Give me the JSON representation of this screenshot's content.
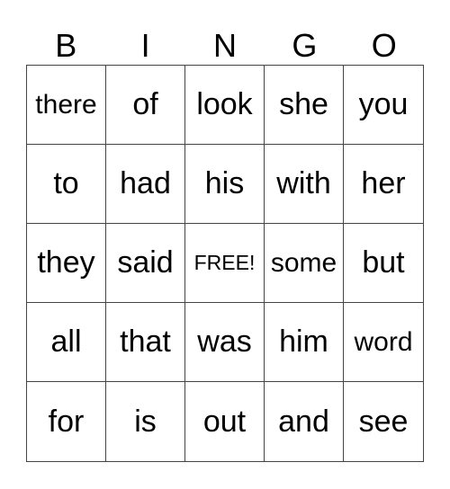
{
  "header": [
    "B",
    "I",
    "N",
    "G",
    "O"
  ],
  "cells": [
    "there",
    "of",
    "look",
    "she",
    "you",
    "to",
    "had",
    "his",
    "with",
    "her",
    "they",
    "said",
    "FREE!",
    "some",
    "but",
    "all",
    "that",
    "was",
    "him",
    "word",
    "for",
    "is",
    "out",
    "and",
    "see"
  ]
}
